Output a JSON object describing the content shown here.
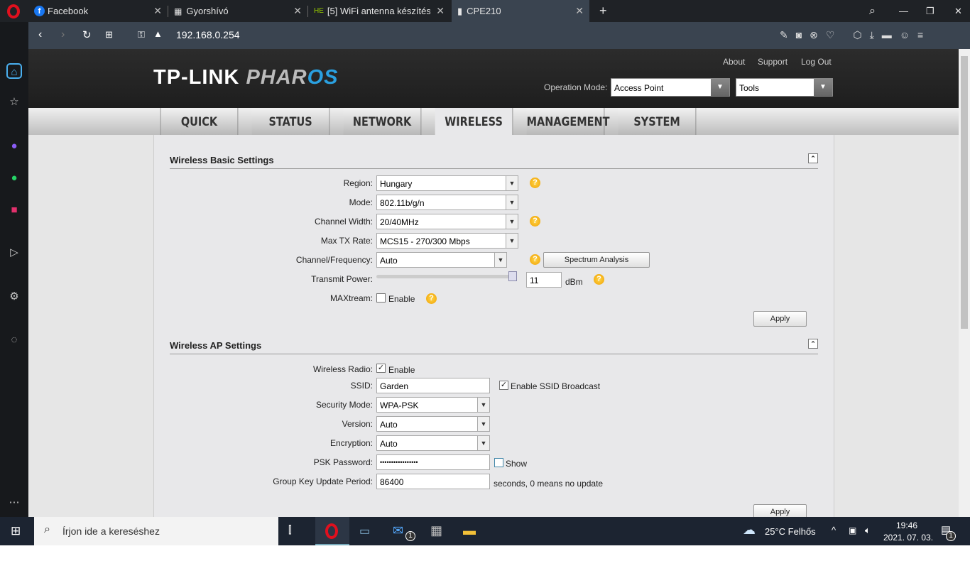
{
  "browser": {
    "tabs": [
      {
        "label": "Facebook",
        "icon": "facebook-icon"
      },
      {
        "label": "Gyorshívó",
        "icon": "speed-dial-icon"
      },
      {
        "label": "[5] WiFi antenna készítés - ",
        "icon": "he-icon",
        "icon_text": "HE"
      },
      {
        "label": "CPE210",
        "icon": "page-icon"
      }
    ],
    "new_tab": "+",
    "url": "192.168.0.254"
  },
  "header": {
    "links": [
      "About",
      "Support",
      "Log Out"
    ],
    "logo_main": "TP-LINK",
    "logo_p": "PHAR",
    "logo_os": "OS",
    "operation_mode_label": "Operation Mode:",
    "operation_mode": "Access Point",
    "tools": "Tools"
  },
  "nav": [
    "QUICK SETUP",
    "STATUS",
    "NETWORK",
    "WIRELESS",
    "MANAGEMENT",
    "SYSTEM"
  ],
  "basic": {
    "title": "Wireless Basic Settings",
    "region_label": "Region:",
    "region": "Hungary",
    "mode_label": "Mode:",
    "mode": "802.11b/g/n",
    "width_label": "Channel Width:",
    "width": "20/40MHz",
    "rate_label": "Max TX Rate:",
    "rate": "MCS15 - 270/300 Mbps",
    "channel_label": "Channel/Frequency:",
    "channel": "Auto",
    "spectrum": "Spectrum Analysis",
    "power_label": "Transmit Power:",
    "power": "11",
    "power_unit": "dBm",
    "power_slider_fraction": 1.0,
    "maxtream_label": "MAXtream:",
    "maxtream_enable": "Enable",
    "maxtream_checked": false,
    "apply": "Apply"
  },
  "ap": {
    "title": "Wireless AP Settings",
    "radio_label": "Wireless Radio:",
    "radio_enable": "Enable",
    "radio_checked": true,
    "ssid_label": "SSID:",
    "ssid": "Garden",
    "broadcast": "Enable SSID Broadcast",
    "broadcast_checked": true,
    "security_label": "Security Mode:",
    "security": "WPA-PSK",
    "version_label": "Version:",
    "version": "Auto",
    "encryption_label": "Encryption:",
    "encryption": "Auto",
    "psk_label": "PSK Password:",
    "psk": "•••••••••••••••••",
    "show": "Show",
    "show_checked": false,
    "gkup_label": "Group Key Update Period:",
    "gkup": "86400",
    "gkup_hint": "seconds, 0 means no update",
    "apply": "Apply"
  },
  "taskbar": {
    "search_placeholder": "Írjon ide a kereséshez",
    "weather": "25°C  Felhős",
    "time": "19:46",
    "date": "2021. 07. 03.",
    "mail_badge": "1",
    "notif_badge": "1"
  }
}
